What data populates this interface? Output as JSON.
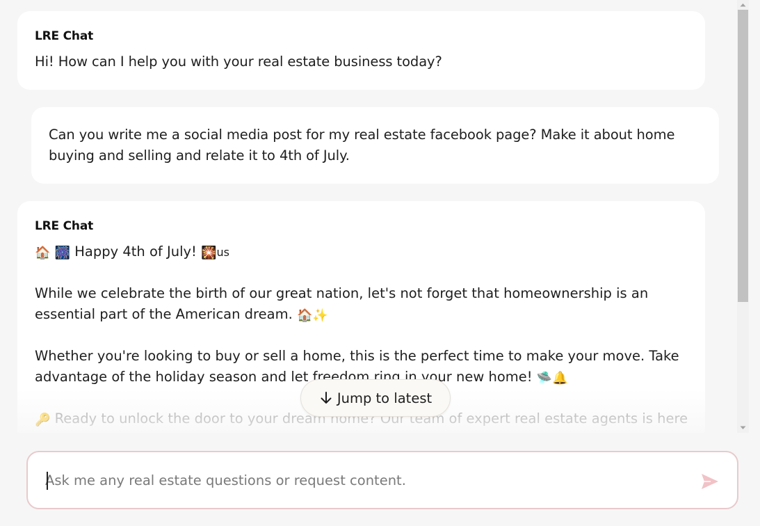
{
  "messages": [
    {
      "role": "bot",
      "sender": "LRE Chat",
      "text": "Hi! How can I help you with your real estate business today?"
    },
    {
      "role": "user",
      "line1": "Can you write me a social media post for my real estate facebook page? Make it about home",
      "line2": "buying and selling and relate it to 4th of July."
    },
    {
      "role": "bot",
      "sender": "LRE Chat",
      "p1": "Happy 4th of July!",
      "p1_suffix": "us",
      "p2_line1": "While we celebrate the birth of our great nation, let's not forget that homeownership is an",
      "p2_line2": "essential part of the American dream.",
      "p3_line1": "Whether you're looking to buy or sell a home, this is the perfect time to make your move. Take",
      "p3_line2": "advantage of the holiday season and let freedom ring in your new home!",
      "p4": "Ready to unlock the door to your dream home? Our team of expert real estate agents is here"
    }
  ],
  "jump_button": {
    "label": "Jump to latest"
  },
  "composer": {
    "placeholder": "Ask me any real estate questions or request content.",
    "value": ""
  },
  "icons": {
    "house_emoji": "🏠",
    "fireworks_emoji": "🎆",
    "sparkler_emoji": "🎇",
    "sparkles_emoji": "✨",
    "moving_emoji": "🛸",
    "bell_emoji": "🔔",
    "key_emoji": "🔑",
    "send_icon": "send-icon",
    "arrow_down_icon": "arrow-down-icon"
  },
  "colors": {
    "page_bg": "#f6f6f6",
    "bubble_bg": "#ffffff",
    "composer_border": "#e9c9cc",
    "send_icon": "#f1c2c7"
  }
}
